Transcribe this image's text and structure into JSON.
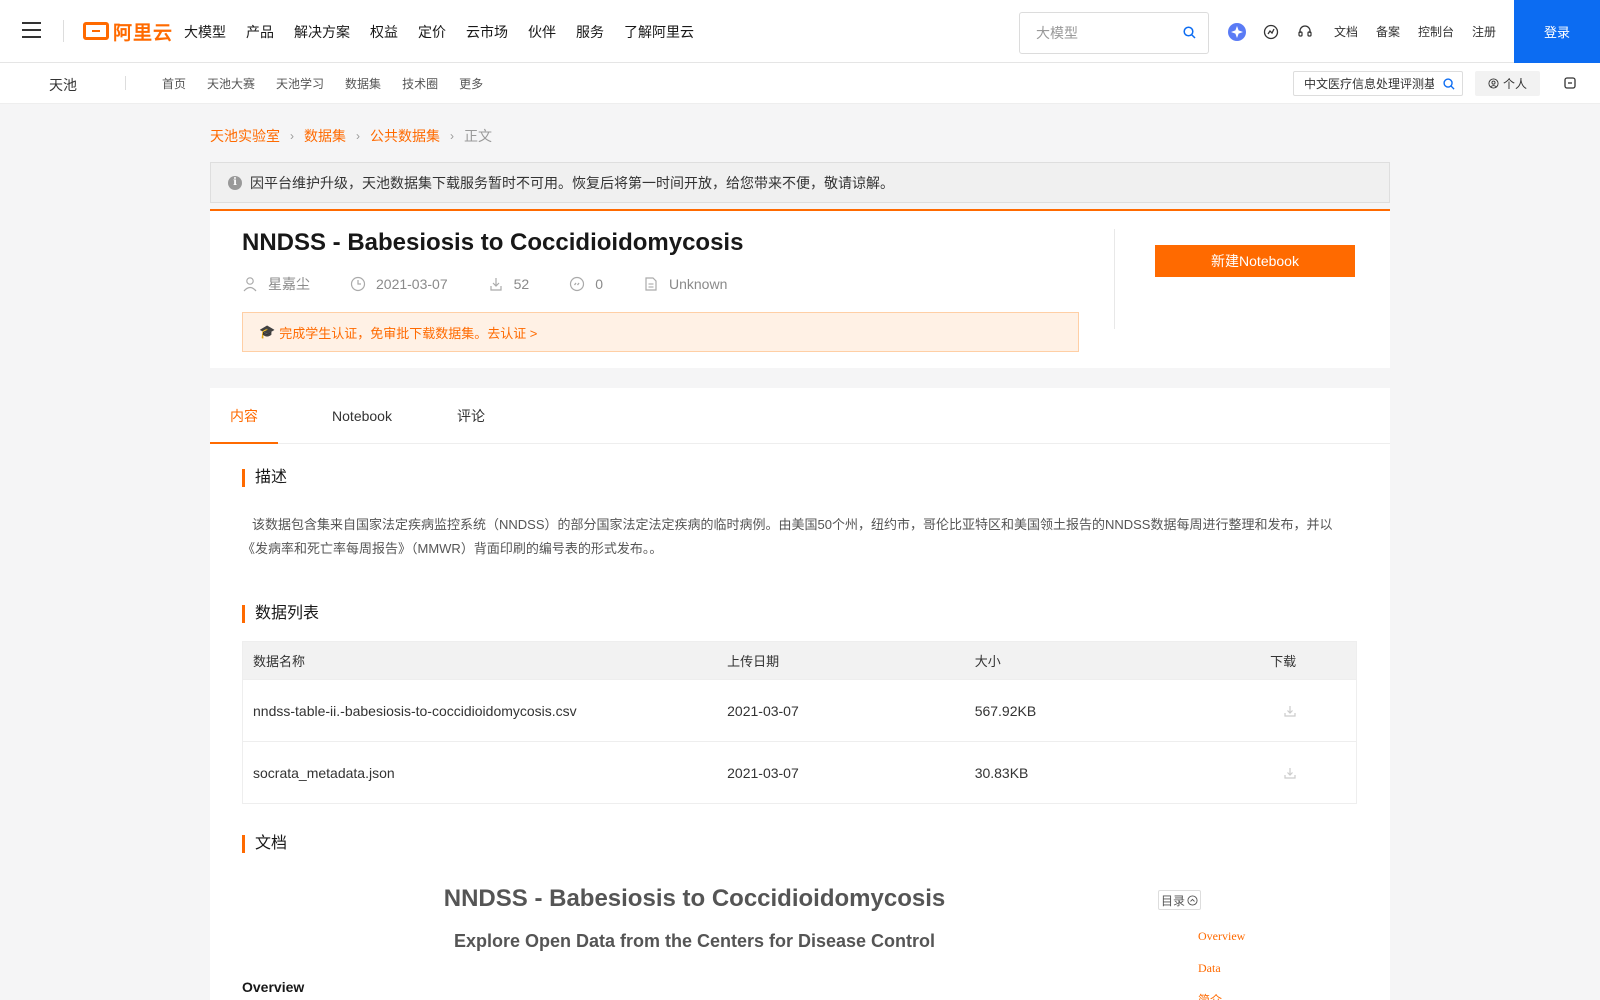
{
  "topbar": {
    "logo_text": "阿里云",
    "nav": [
      "大模型",
      "产品",
      "解决方案",
      "权益",
      "定价",
      "云市场",
      "伙伴",
      "服务",
      "了解阿里云"
    ],
    "search_placeholder": "大模型",
    "links": [
      "文档",
      "备案",
      "控制台",
      "注册"
    ],
    "login": "登录"
  },
  "subbar": {
    "brand": "天池",
    "nav": [
      "首页",
      "天池大赛",
      "天池学习",
      "数据集",
      "技术圈",
      "更多"
    ],
    "search_value": "中文医疗信息处理评测基",
    "personal": "个人"
  },
  "breadcrumb": [
    "天池实验室",
    "数据集",
    "公共数据集",
    "正文"
  ],
  "notice": "因平台维护升级，天池数据集下载服务暂时不可用。恢复后将第一时间开放，给您带来不便，敬请谅解。",
  "dataset": {
    "title": "NNDSS - Babesiosis to Coccidioidomycosis",
    "author": "星嘉尘",
    "date": "2021-03-07",
    "downloads": "52",
    "citations": "0",
    "license": "Unknown",
    "edu_banner": "完成学生认证，免审批下载数据集。去认证 >",
    "new_notebook": "新建Notebook"
  },
  "tabs": [
    "内容",
    "Notebook",
    "评论"
  ],
  "content": {
    "desc_title": "描述",
    "desc_text": "该数据包含集来自国家法定疾病监控系统（NNDSS）的部分国家法定法定疾病的临时病例。由美国50个州，纽约市，哥伦比亚特区和美国领土报告的NNDSS数据每周进行整理和发布，并以《发病率和死亡率每周报告》（MMWR）背面印刷的编号表的形式发布。。",
    "list_title": "数据列表",
    "table_headers": [
      "数据名称",
      "上传日期",
      "大小",
      "下载"
    ],
    "files": [
      {
        "name": "nndss-table-ii.-babesiosis-to-coccidioidomycosis.csv",
        "date": "2021-03-07",
        "size": "567.92KB"
      },
      {
        "name": "socrata_metadata.json",
        "date": "2021-03-07",
        "size": "30.83KB"
      }
    ],
    "doc_title": "文档",
    "doc_h1": "NNDSS - Babesiosis to Coccidioidomycosis",
    "doc_h2": "Explore Open Data from the Centers for Disease Control",
    "doc_h3": "Overview",
    "toc_label": "目录",
    "toc": [
      "Overview",
      "Data",
      "简介"
    ]
  },
  "colors": {
    "accent": "#ff6a00",
    "login_blue": "#0c6cf2"
  }
}
